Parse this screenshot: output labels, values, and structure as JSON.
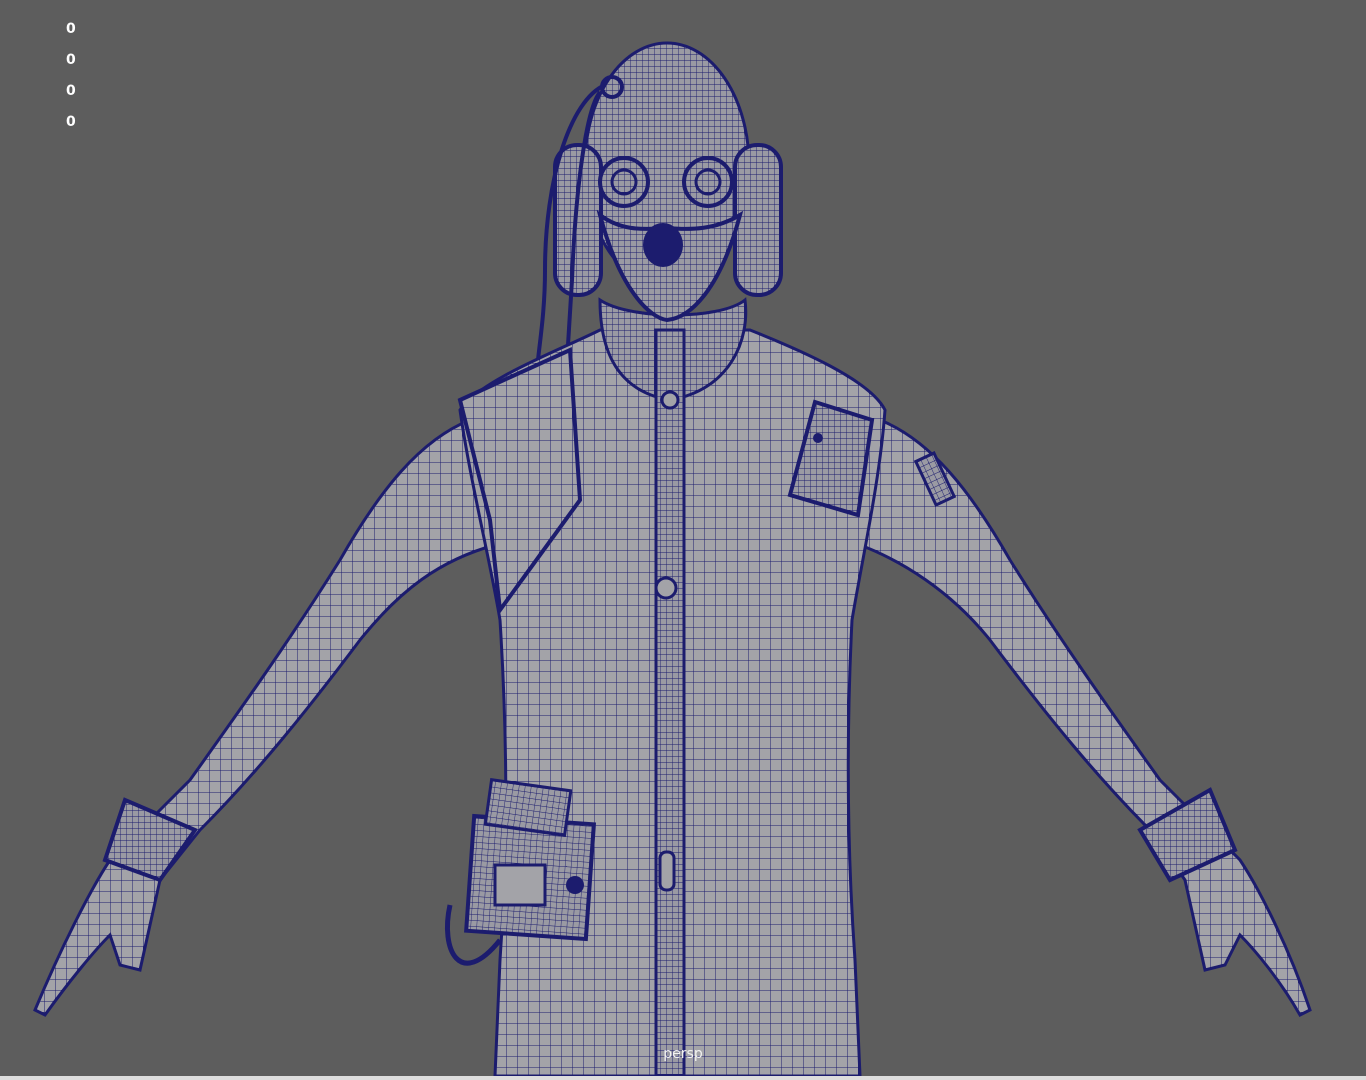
{
  "viewport": {
    "hud_values": [
      "0",
      "0",
      "0",
      "0"
    ],
    "camera_label": "persp"
  },
  "colors": {
    "background": "#5d5d5d",
    "mesh_fill": "#a3a3a8",
    "wireframe": "#1c1c6e",
    "hud_text": "#ffffff"
  },
  "model": {
    "display_mode": "wireframe-on-shaded"
  }
}
